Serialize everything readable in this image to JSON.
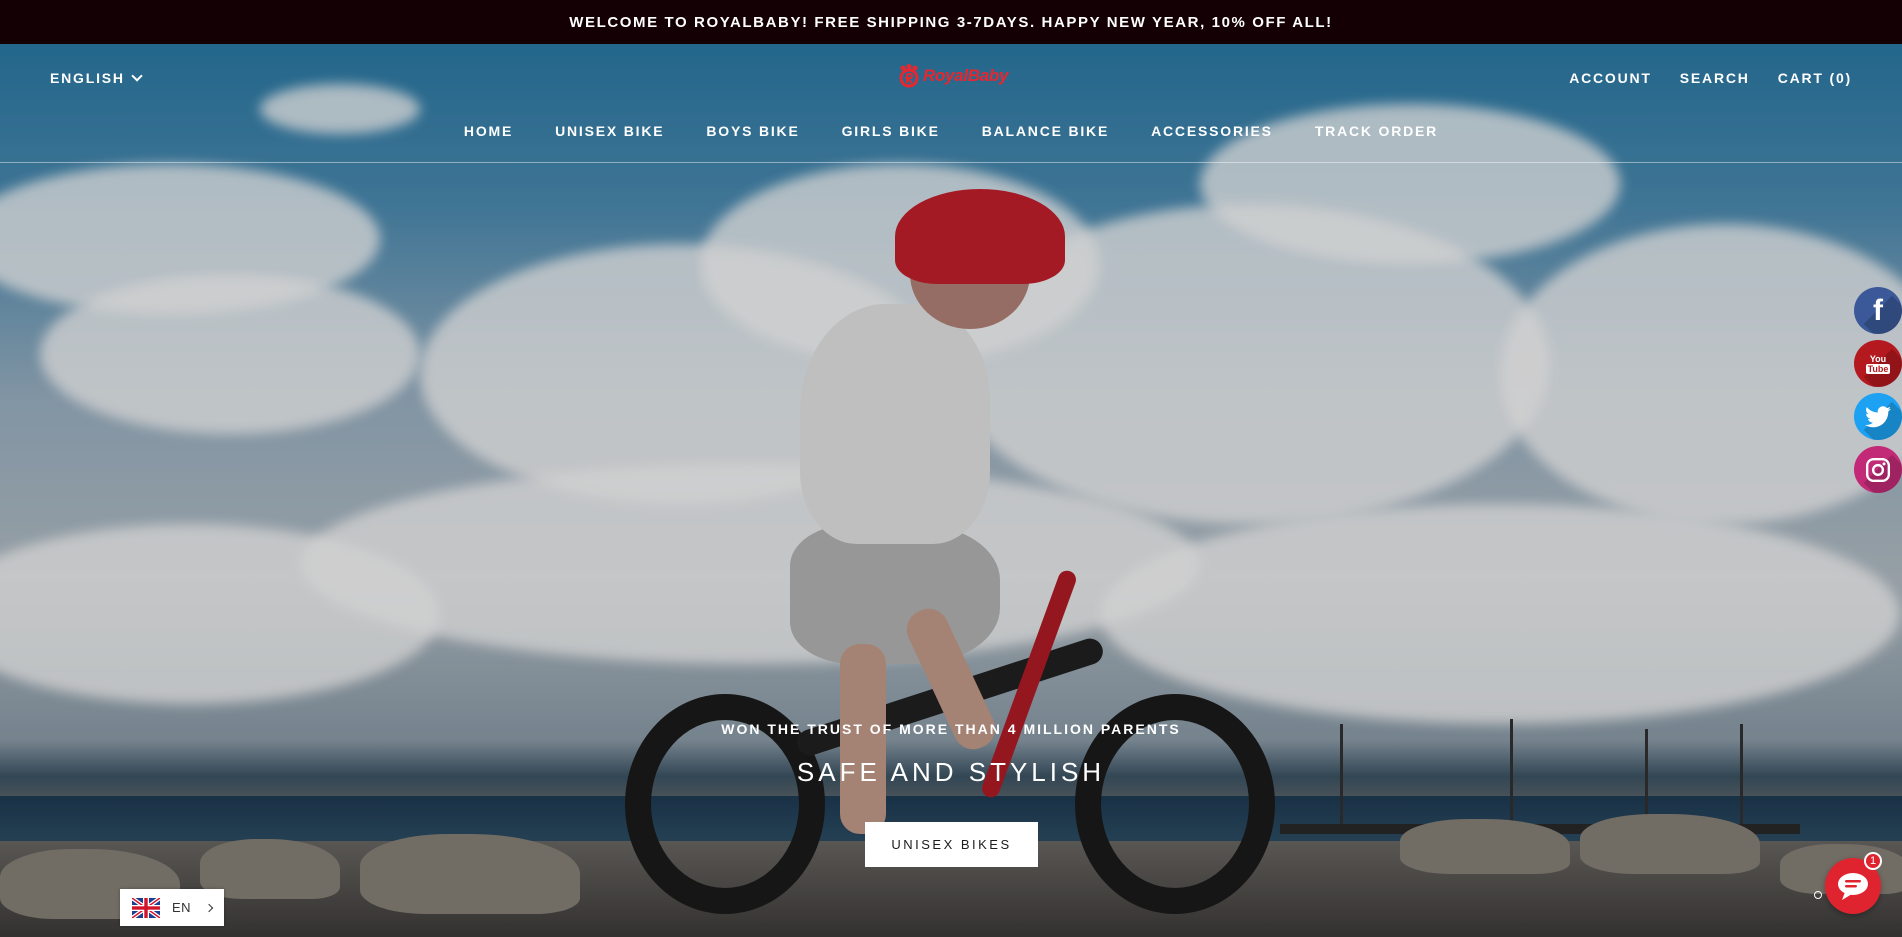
{
  "announcement": "WELCOME TO ROYALBABY! FREE SHIPPING 3-7DAYS. HAPPY NEW YEAR, 10% OFF ALL!",
  "header": {
    "language": "ENGLISH",
    "logo_text": "RoyalBaby",
    "account": "ACCOUNT",
    "search": "SEARCH",
    "cart": "CART (0)"
  },
  "nav": {
    "items": [
      {
        "label": "HOME"
      },
      {
        "label": "UNISEX BIKE"
      },
      {
        "label": "BOYS BIKE"
      },
      {
        "label": "GIRLS BIKE"
      },
      {
        "label": "BALANCE BIKE"
      },
      {
        "label": "ACCESSORIES"
      },
      {
        "label": "TRACK ORDER"
      }
    ]
  },
  "hero": {
    "eyebrow": "WON THE TRUST OF MORE THAN 4 MILLION PARENTS",
    "headline": "SAFE AND STYLISH",
    "cta": "UNISEX BIKES"
  },
  "social": [
    {
      "name": "facebook-icon",
      "glyph": "f",
      "color": "#3b5998"
    },
    {
      "name": "youtube-icon",
      "glyph": "You Tube",
      "color": "#c4302b"
    },
    {
      "name": "twitter-icon",
      "glyph": "🐦",
      "color": "#1da1f2"
    },
    {
      "name": "instagram-icon",
      "glyph": "◎",
      "color": "#c13584"
    }
  ],
  "language_widget": {
    "code": "EN"
  },
  "chat": {
    "badge": "1"
  },
  "colors": {
    "brand": "#e8262e",
    "announcement_bg": "#140004"
  }
}
